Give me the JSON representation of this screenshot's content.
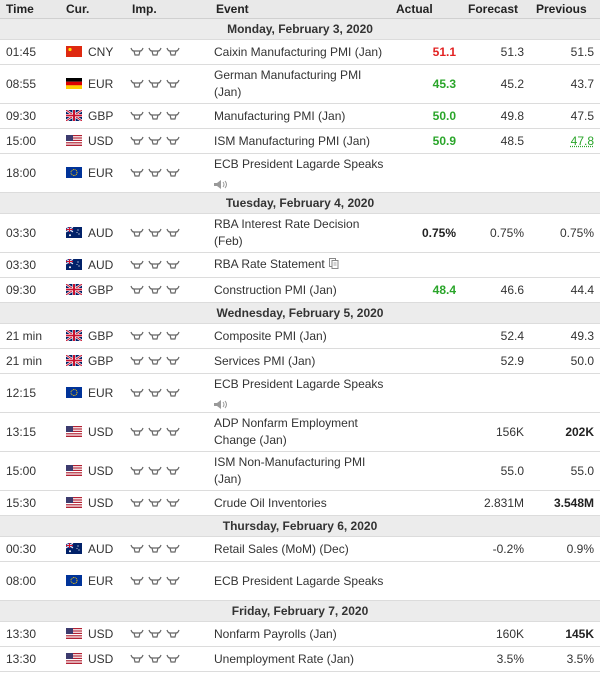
{
  "headers": {
    "time": "Time",
    "cur": "Cur.",
    "imp": "Imp.",
    "event": "Event",
    "actual": "Actual",
    "forecast": "Forecast",
    "previous": "Previous"
  },
  "rows": [
    {
      "type": "day",
      "label": "Monday, February 3, 2020"
    },
    {
      "time": "01:45",
      "flag": "cn",
      "cur": "CNY",
      "event": "Caixin Manufacturing PMI (Jan)",
      "actual": "51.1",
      "actual_style": "red",
      "forecast": "51.3",
      "previous": "51.5"
    },
    {
      "time": "08:55",
      "flag": "de",
      "cur": "EUR",
      "event": "German Manufacturing PMI (Jan)",
      "actual": "45.3",
      "actual_style": "green",
      "forecast": "45.2",
      "previous": "43.7",
      "tall": true
    },
    {
      "time": "09:30",
      "flag": "gb",
      "cur": "GBP",
      "event": "Manufacturing PMI (Jan)",
      "actual": "50.0",
      "actual_style": "green",
      "forecast": "49.8",
      "previous": "47.5"
    },
    {
      "time": "15:00",
      "flag": "us",
      "cur": "USD",
      "event": "ISM Manufacturing PMI (Jan)",
      "actual": "50.9",
      "actual_style": "green",
      "forecast": "48.5",
      "previous": "47.8",
      "previous_style": "greenu"
    },
    {
      "time": "18:00",
      "flag": "eu",
      "cur": "EUR",
      "event": "ECB President Lagarde Speaks",
      "speaker": true,
      "actual": "",
      "forecast": "",
      "previous": "",
      "tall": true
    },
    {
      "type": "day",
      "label": "Tuesday, February 4, 2020"
    },
    {
      "time": "03:30",
      "flag": "au",
      "cur": "AUD",
      "event": "RBA Interest Rate Decision (Feb)",
      "actual": "0.75%",
      "actual_style": "bold",
      "forecast": "0.75%",
      "previous": "0.75%",
      "tall": true
    },
    {
      "time": "03:30",
      "flag": "au",
      "cur": "AUD",
      "event": "RBA Rate Statement",
      "doc": true,
      "actual": "",
      "forecast": "",
      "previous": ""
    },
    {
      "time": "09:30",
      "flag": "gb",
      "cur": "GBP",
      "event": "Construction PMI (Jan)",
      "actual": "48.4",
      "actual_style": "green",
      "forecast": "46.6",
      "previous": "44.4"
    },
    {
      "type": "day",
      "label": "Wednesday, February 5, 2020"
    },
    {
      "time": "21 min",
      "flag": "gb",
      "cur": "GBP",
      "event": "Composite PMI (Jan)",
      "actual": "",
      "forecast": "52.4",
      "previous": "49.3"
    },
    {
      "time": "21 min",
      "flag": "gb",
      "cur": "GBP",
      "event": "Services PMI (Jan)",
      "actual": "",
      "forecast": "52.9",
      "previous": "50.0"
    },
    {
      "time": "12:15",
      "flag": "eu",
      "cur": "EUR",
      "event": "ECB President Lagarde Speaks",
      "speaker": true,
      "actual": "",
      "forecast": "",
      "previous": "",
      "tall": true
    },
    {
      "time": "13:15",
      "flag": "us",
      "cur": "USD",
      "event": "ADP Nonfarm Employment Change (Jan)",
      "actual": "",
      "forecast": "156K",
      "previous": "202K",
      "previous_style": "bold",
      "tall": true
    },
    {
      "time": "15:00",
      "flag": "us",
      "cur": "USD",
      "event": "ISM Non-Manufacturing PMI (Jan)",
      "actual": "",
      "forecast": "55.0",
      "previous": "55.0",
      "tall": true
    },
    {
      "time": "15:30",
      "flag": "us",
      "cur": "USD",
      "event": "Crude Oil Inventories",
      "actual": "",
      "forecast": "2.831M",
      "previous": "3.548M",
      "previous_style": "bold"
    },
    {
      "type": "day",
      "label": "Thursday, February 6, 2020"
    },
    {
      "time": "00:30",
      "flag": "au",
      "cur": "AUD",
      "event": "Retail Sales (MoM) (Dec)",
      "actual": "",
      "forecast": "-0.2%",
      "previous": "0.9%"
    },
    {
      "time": "08:00",
      "flag": "eu",
      "cur": "EUR",
      "event": "ECB President Lagarde Speaks",
      "actual": "",
      "forecast": "",
      "previous": "",
      "tall": true
    },
    {
      "type": "day",
      "label": "Friday, February 7, 2020"
    },
    {
      "time": "13:30",
      "flag": "us",
      "cur": "USD",
      "event": "Nonfarm Payrolls (Jan)",
      "actual": "",
      "forecast": "160K",
      "previous": "145K",
      "previous_style": "bold"
    },
    {
      "time": "13:30",
      "flag": "us",
      "cur": "USD",
      "event": "Unemployment Rate (Jan)",
      "actual": "",
      "forecast": "3.5%",
      "previous": "3.5%"
    }
  ]
}
